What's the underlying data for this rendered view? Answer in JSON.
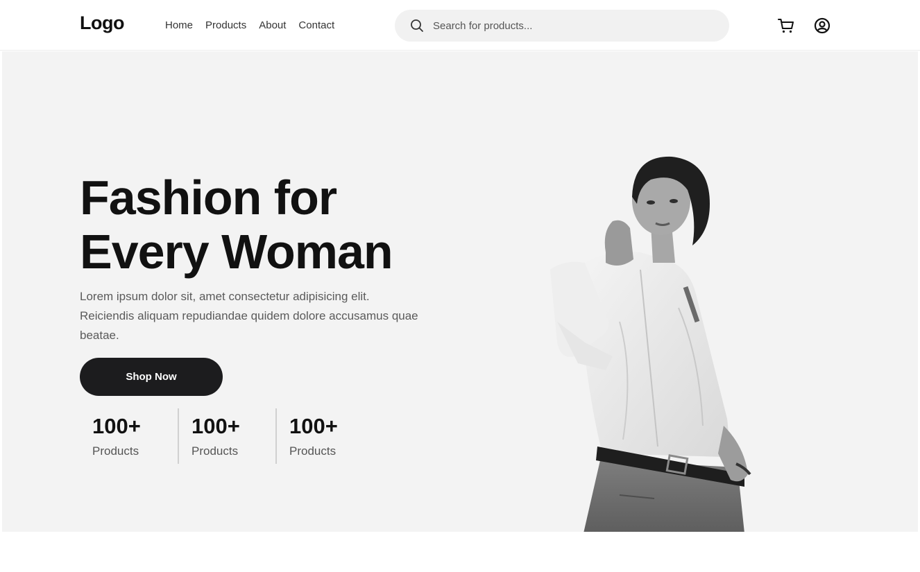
{
  "header": {
    "logo": "Logo",
    "nav": [
      {
        "label": "Home"
      },
      {
        "label": "Products"
      },
      {
        "label": "About"
      },
      {
        "label": "Contact"
      }
    ],
    "search": {
      "placeholder": "Search for products...",
      "value": "",
      "icon": "search-icon"
    },
    "actions": {
      "cart_icon": "cart-icon",
      "user_icon": "user-circle-icon"
    }
  },
  "hero": {
    "title": "Fashion for\nEvery Woman",
    "description": "Lorem ipsum dolor sit, amet consectetur adipisicing elit. Reiciendis aliquam repudiandae quidem dolore accusamus quae beatae.",
    "cta_label": "Shop Now",
    "stats": [
      {
        "value": "100+",
        "label": "Products"
      },
      {
        "value": "100+",
        "label": "Products"
      },
      {
        "value": "100+",
        "label": "Products"
      }
    ],
    "image": "woman-model-photo"
  },
  "colors": {
    "hero_bg": "#f3f3f3",
    "button_bg": "#1c1c1e",
    "search_bg": "#f1f1f1"
  }
}
